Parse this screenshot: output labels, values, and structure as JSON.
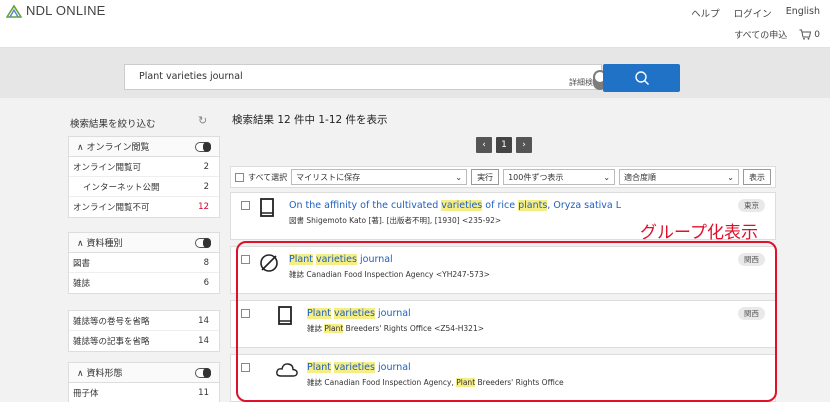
{
  "header": {
    "logo_text": "NDL ONLINE",
    "links": [
      "ヘルプ",
      "ログイン",
      "English"
    ],
    "all_requests": "すべての申込",
    "cart_count": "0"
  },
  "search": {
    "query": "Plant varieties journal",
    "advanced_label": "詳細検索"
  },
  "sidebar": {
    "title": "検索結果を絞り込む",
    "facets": [
      {
        "head": "オンライン閲覧",
        "rows": [
          {
            "label": "オンライン閲覧可",
            "count": "2"
          },
          {
            "label": "インターネット公開",
            "count": "2"
          },
          {
            "label": "オンライン閲覧不可",
            "count": "12"
          }
        ]
      },
      {
        "head": "資料種別",
        "rows": [
          {
            "label": "図書",
            "count": "8"
          },
          {
            "label": "雑誌",
            "count": "6"
          }
        ]
      },
      {
        "head": "",
        "rows": [
          {
            "label": "雑誌等の巻号を省略",
            "count": "14"
          },
          {
            "label": "雑誌等の記事を省略",
            "count": "14"
          }
        ]
      },
      {
        "head": "資料形態",
        "rows": [
          {
            "label": "冊子体",
            "count": "11"
          }
        ]
      }
    ]
  },
  "results": {
    "summary": "検索結果 12 件中 1-12 件を表示",
    "page": "1",
    "toolbar": {
      "select_all": "すべて選択",
      "mylist": "マイリストに保存",
      "run": "実行",
      "per_page": "100件ずつ表示",
      "sort": "適合度順",
      "show": "表示"
    },
    "records": [
      {
        "title_parts": [
          "On the affinity of the cultivated ",
          "varieties",
          " of rice ",
          "plants",
          ", Oryza sativa L"
        ],
        "meta": "図書 Shigemoto Kato [著]. [出版者不明], [1930] <235-92>",
        "badge": "東京",
        "icon": "book-icon"
      },
      {
        "title_parts": [
          "Plant",
          " ",
          "varieties",
          " ",
          "journal"
        ],
        "meta": "雑誌 Canadian Food Inspection Agency <YH247-573>",
        "badge": "関西",
        "icon": "no-image-icon"
      },
      {
        "title_parts": [
          "Plant",
          " ",
          "varieties",
          " ",
          "journal"
        ],
        "meta_parts": [
          "雑誌 ",
          "Plant",
          " Breeders' Rights Office <Z54-H321>"
        ],
        "badge": "関西",
        "icon": "book-icon"
      },
      {
        "title_parts": [
          "Plant",
          " ",
          "varieties",
          " ",
          "journal"
        ],
        "meta_parts": [
          "雑誌 Canadian Food Inspection Agency, ",
          "Plant",
          " Breeders' Rights Office"
        ],
        "badge": "",
        "icon": "cloud-icon"
      }
    ]
  },
  "annotation": {
    "group_label": "グループ化表示",
    "color": "#e0102b"
  },
  "colors": {
    "primary": "#1f72c6",
    "highlight": "#f5ee86",
    "link": "#1f5fbf"
  }
}
